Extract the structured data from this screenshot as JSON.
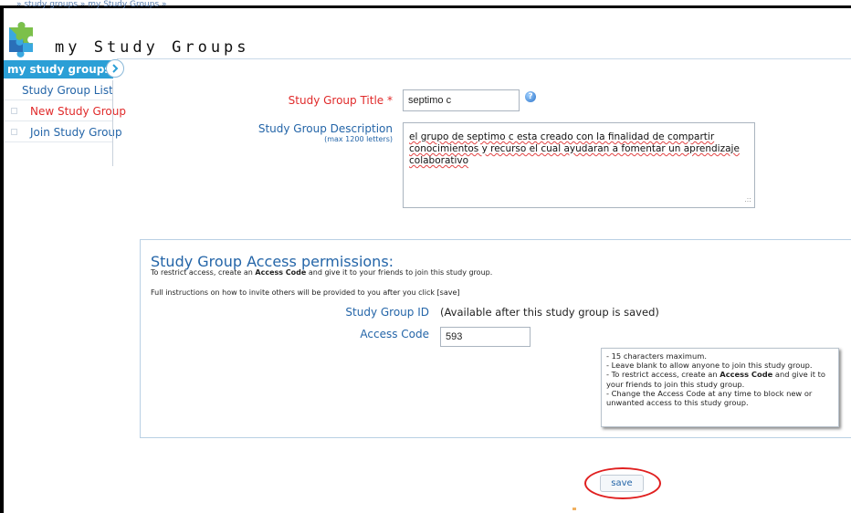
{
  "breadcrumb": "» study groups » my Study Groups »",
  "page": {
    "title": "my Study Groups"
  },
  "sidebar": {
    "header": "my study groups",
    "items": [
      {
        "label": "Study Group List",
        "color": "#2465a8"
      },
      {
        "label": "New Study Group",
        "color": "#e02a2a"
      },
      {
        "label": "Join Study Group",
        "color": "#2465a8"
      }
    ]
  },
  "form": {
    "title_label": "Study Group Title *",
    "title_value": "septimo c",
    "description_label": "Study Group Description",
    "description_hint": "(max 1200 letters)",
    "description_value": "el grupo de septimo c esta creado con la finalidad de compartir conocimientos y recurso el cual ayudaran a fomentar un aprendizaje colaborativo"
  },
  "permissions": {
    "title": "Study Group Access permissions:",
    "subtitle_before": "To restrict access, create an ",
    "subtitle_bold": "Access Code",
    "subtitle_after": " and give it to your friends to join this study group.",
    "instructions": "Full instructions on how to invite others will be provided to you after you click [save]",
    "id_label": "Study Group ID",
    "id_value": "(Available after this study group is saved)",
    "code_label": "Access Code",
    "code_value": "593"
  },
  "tooltip": {
    "line1": "- 15 characters maximum.",
    "line2": "- Leave blank to allow anyone to join this study group.",
    "line3_before": "- To restrict access, create an ",
    "line3_bold": "Access Code",
    "line3_after": " and give it to your friends to join this study group.",
    "line4": "- Change the Access Code at any time to block new or unwanted access to this study group."
  },
  "buttons": {
    "save": "save"
  },
  "colors": {
    "accent": "#2b9fd6",
    "link": "#2465a8",
    "required": "#e02a2a",
    "highlight_circle": "#e02020"
  }
}
